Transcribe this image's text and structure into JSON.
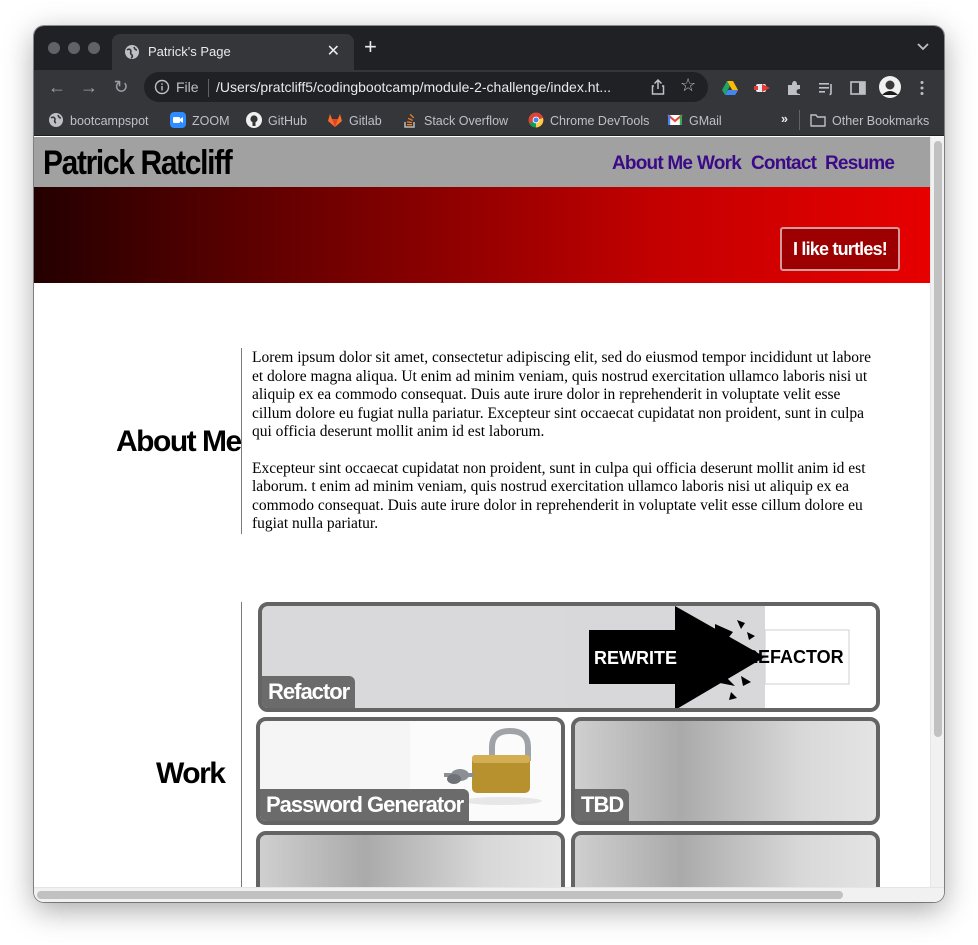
{
  "browser": {
    "tab_title": "Patrick's Page",
    "address_scheme": "File",
    "address_url": "/Users/pratcliff5/codingbootcamp/module-2-challenge/index.ht..."
  },
  "bookmarks": [
    {
      "label": "bootcampspot",
      "icon": "globe-icon"
    },
    {
      "label": "ZOOM",
      "icon": "zoom-icon"
    },
    {
      "label": "GitHub",
      "icon": "github-icon"
    },
    {
      "label": "Gitlab",
      "icon": "gitlab-icon"
    },
    {
      "label": "Stack Overflow",
      "icon": "stackoverflow-icon"
    },
    {
      "label": "Chrome DevTools",
      "icon": "chrome-icon"
    },
    {
      "label": "GMail",
      "icon": "gmail-icon"
    }
  ],
  "bookmarks_overflow": "»",
  "other_bookmarks": "Other Bookmarks",
  "site": {
    "name": "Patrick Ratcliff",
    "nav": [
      "About Me",
      "Work",
      "Contact",
      "Resume"
    ],
    "hero_badge": "I like turtles!",
    "about": {
      "heading": "About Me",
      "paragraphs": [
        "Lorem ipsum dolor sit amet, consectetur adipiscing elit, sed do eiusmod tempor incididunt ut labore et dolore magna aliqua. Ut enim ad minim veniam, quis nostrud exercitation ullamco laboris nisi ut aliquip ex ea commodo consequat. Duis aute irure dolor in reprehenderit in voluptate velit esse cillum dolore eu fugiat nulla pariatur. Excepteur sint occaecat cupidatat non proident, sunt in culpa qui officia deserunt mollit anim id est laborum.",
        "Excepteur sint occaecat cupidatat non proident, sunt in culpa qui officia deserunt mollit anim id est laborum. t enim ad minim veniam, quis nostrud exercitation ullamco laboris nisi ut aliquip ex ea commodo consequat. Duis aute irure dolor in reprehenderit in voluptate velit esse cillum dolore eu fugiat nulla pariatur."
      ]
    },
    "work": {
      "heading": "Work",
      "cards": [
        {
          "label": "Refactor",
          "image_text_left": "REWRITE",
          "image_text_right": "REFACTOR"
        },
        {
          "label": "Password Generator"
        },
        {
          "label": "TBD"
        },
        {
          "label": ""
        },
        {
          "label": ""
        }
      ]
    }
  },
  "colors": {
    "header_bg": "#a1a1a1",
    "nav_link": "#3b0a87",
    "hero_start": "#240000",
    "hero_end": "#e70000",
    "card_border": "#646464"
  }
}
